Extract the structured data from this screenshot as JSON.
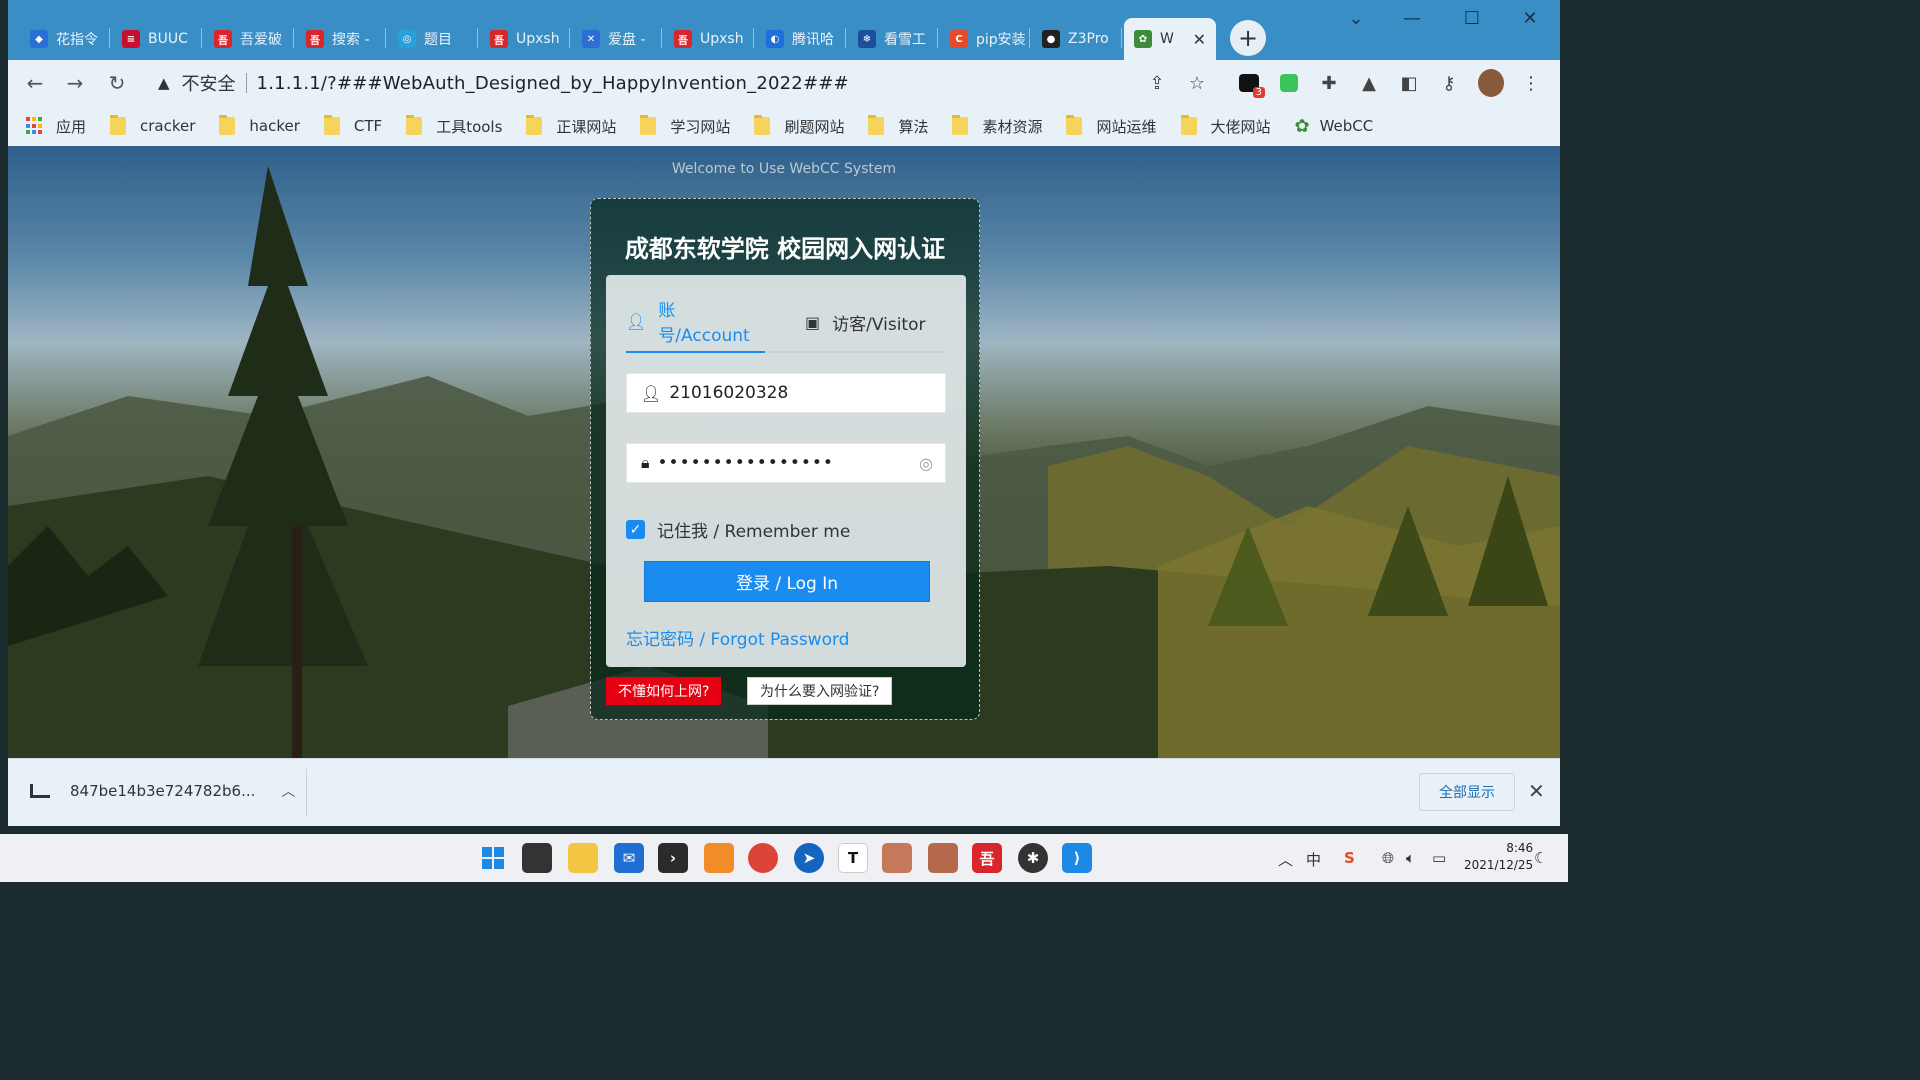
{
  "browser": {
    "tabs": [
      {
        "label": "花指令",
        "color": "#2b6fd6",
        "glyph": "◆"
      },
      {
        "label": "BUUC",
        "color": "#c8102e",
        "glyph": "≡"
      },
      {
        "label": "吾爱破",
        "color": "#d9262b",
        "glyph": "吾"
      },
      {
        "label": "搜索 -",
        "color": "#d9262b",
        "glyph": "吾"
      },
      {
        "label": "题目",
        "color": "#2a9fd8",
        "glyph": "◎"
      },
      {
        "label": "Upxsh",
        "color": "#d9262b",
        "glyph": "吾"
      },
      {
        "label": "爱盘 -",
        "color": "#2b6fd6",
        "glyph": "✕"
      },
      {
        "label": "Upxsh",
        "color": "#d9262b",
        "glyph": "吾"
      },
      {
        "label": "腾讯哈",
        "color": "#1d6fd9",
        "glyph": "◐"
      },
      {
        "label": "看雪工",
        "color": "#1b4f9a",
        "glyph": "❄"
      },
      {
        "label": "pip安装",
        "color": "#e8492b",
        "glyph": "C"
      },
      {
        "label": "Z3Pro",
        "color": "#222222",
        "glyph": "●"
      }
    ],
    "active_tab": {
      "label": "W",
      "close": "✕"
    },
    "new_tab": "+",
    "window_controls": {
      "chevron": "⌄",
      "minimize": "—",
      "maximize": "☐",
      "close": "✕"
    },
    "nav": {
      "back": "←",
      "forward": "→",
      "reload": "↻"
    },
    "address": {
      "warning_icon": "▲",
      "insecure_label": "不安全",
      "url": "1.1.1.1/?###WebAuth_Designed_by_HappyInvention_2022###"
    },
    "extension_badge": "3",
    "bookmarks": [
      "应用",
      "cracker",
      "hacker",
      "CTF",
      "工具tools",
      "正课网站",
      "学习网站",
      "刷题网站",
      "算法",
      "素材资源",
      "网站运维",
      "大佬网站",
      "WebCC"
    ]
  },
  "portal": {
    "welcome": "Welcome to Use WebCC System",
    "title": "成都东软学院 校园网入网认证",
    "tab_account": "账号/Account",
    "tab_visitor": "访客/Visitor",
    "username_value": "21016020328",
    "password_value": "••••••••••••••••",
    "remember_label": "记住我 / Remember me",
    "remember_checked": true,
    "login_button": "登录 / Log In",
    "forgot_link": "忘记密码 / Forgot Password",
    "help_how": "不懂如何上网?",
    "help_why": "为什么要入网验证?",
    "accent_color": "#1a8cf0"
  },
  "downloads": {
    "file_name": "847be14b3e724782b6...",
    "show_all": "全部显示",
    "close": "✕"
  },
  "taskbar": {
    "time": "8:46",
    "date": "2021/12/25",
    "ime": "中"
  }
}
